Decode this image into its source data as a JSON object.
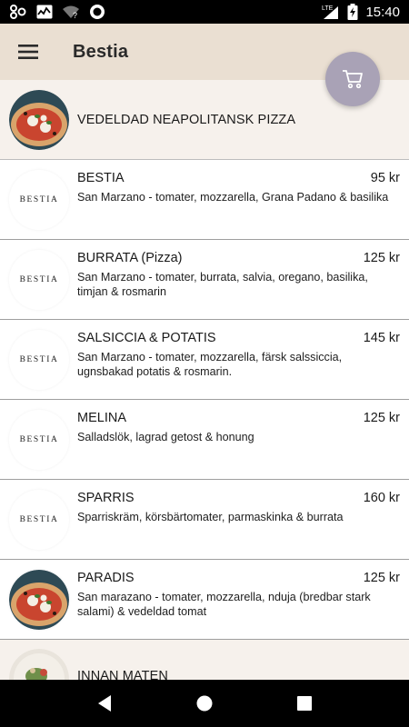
{
  "status_bar": {
    "time": "15:40",
    "network": "LTE",
    "icons": [
      "notification-icon",
      "activity-icon",
      "wifi-unknown-icon",
      "record-icon",
      "signal-icon",
      "battery-charging-icon"
    ]
  },
  "app_bar": {
    "title": "Bestia",
    "menu_icon": "hamburger-menu-icon",
    "cart_icon": "shopping-cart-icon"
  },
  "categories": {
    "top": {
      "name": "VEDELDAD NEAPOLITANSK PIZZA",
      "thumb": "pizza-image"
    },
    "bottom": {
      "name": "INNAN MATEN",
      "thumb": "dish-image"
    }
  },
  "brand_logo_text": "BESTIA",
  "items": [
    {
      "name": "BESTIA",
      "price": "95 kr",
      "description": "San Marzano - tomater, mozzarella, Grana Padano & basilika",
      "thumb": "logo"
    },
    {
      "name": "BURRATA (Pizza)",
      "price": "125 kr",
      "description": "San Marzano - tomater, burrata, salvia, oregano, basilika, timjan & rosmarin",
      "thumb": "logo"
    },
    {
      "name": "SALSICCIA & POTATIS",
      "price": "145 kr",
      "description": "San Marzano - tomater, mozzarella, färsk salssiccia, ugnsbakad potatis & rosmarin.",
      "thumb": "logo"
    },
    {
      "name": "MELINA",
      "price": "125 kr",
      "description": "Salladslök, lagrad getost & honung",
      "thumb": "logo"
    },
    {
      "name": "SPARRIS",
      "price": "160 kr",
      "description": "Sparriskräm, körsbärtomater, parmaskinka & burrata",
      "thumb": "logo"
    },
    {
      "name": "PARADIS",
      "price": "125 kr",
      "description": "San marazano - tomater, mozzarella, nduja (bredbar stark salami) & vedeldad tomat",
      "thumb": "pizza"
    }
  ],
  "nav_bar": {
    "buttons": [
      "back-icon",
      "home-icon",
      "recents-icon"
    ]
  },
  "colors": {
    "app_bar_bg": "#eadfd2",
    "category_bg": "#f6f1ec",
    "cart_fab_bg": "#a9a2b6",
    "status_bar_bg": "#000000"
  }
}
